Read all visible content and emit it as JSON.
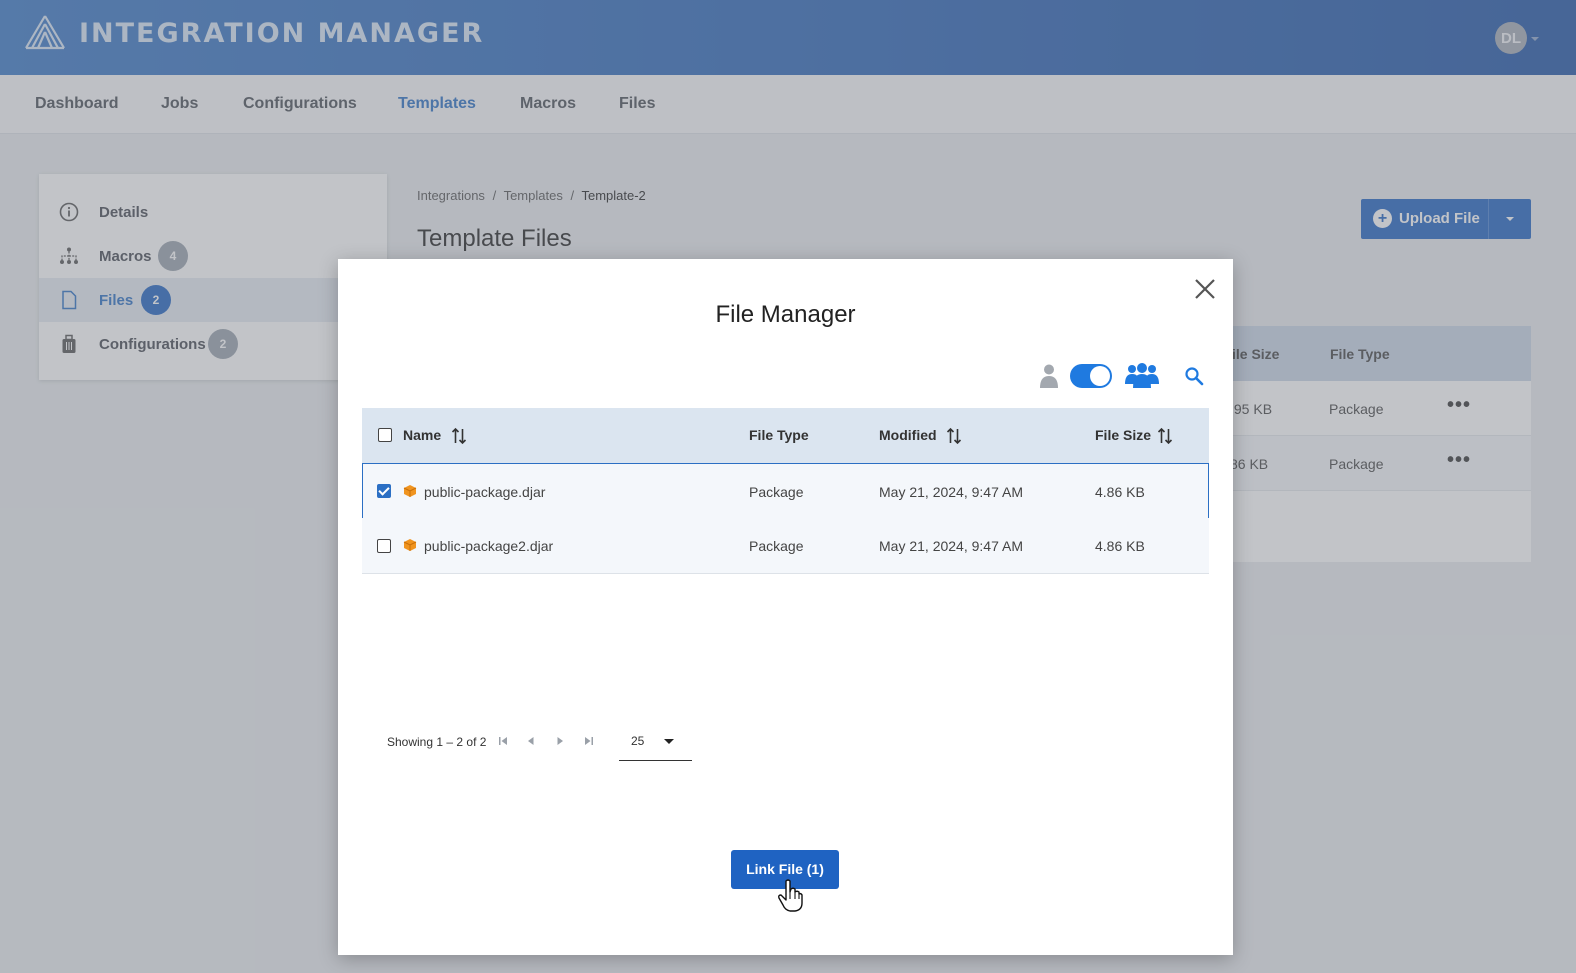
{
  "app": {
    "title": "INTEGRATION MANAGER",
    "user_initials": "DL"
  },
  "nav": {
    "items": [
      {
        "label": "Dashboard",
        "active": false
      },
      {
        "label": "Jobs",
        "active": false
      },
      {
        "label": "Configurations",
        "active": false
      },
      {
        "label": "Templates",
        "active": true
      },
      {
        "label": "Macros",
        "active": false
      },
      {
        "label": "Files",
        "active": false
      }
    ]
  },
  "sidebar": {
    "items": [
      {
        "label": "Details",
        "icon": "info-icon"
      },
      {
        "label": "Macros",
        "icon": "hierarchy-icon",
        "badge": "4"
      },
      {
        "label": "Files",
        "icon": "file-icon",
        "badge": "2",
        "active": true
      },
      {
        "label": "Configurations",
        "icon": "luggage-icon",
        "badge": "2"
      }
    ]
  },
  "page": {
    "breadcrumb": [
      "Integrations",
      "/",
      "Templates",
      "/",
      "Template-2"
    ],
    "title": "Template Files",
    "upload_label": "Upload File",
    "bg_table": {
      "headers": [
        "ile Size",
        "File Type"
      ],
      "rows": [
        {
          "size": ".95 KB",
          "type": "Package"
        },
        {
          "size": "86 KB",
          "type": "Package"
        }
      ]
    }
  },
  "modal": {
    "title": "File Manager",
    "columns": {
      "name": "Name",
      "type": "File Type",
      "modified": "Modified",
      "size": "File Size"
    },
    "rows": [
      {
        "name": "public-package.djar",
        "type": "Package",
        "modified": "May 21, 2024, 9:47 AM",
        "size": "4.86 KB",
        "checked": true
      },
      {
        "name": "public-package2.djar",
        "type": "Package",
        "modified": "May 21, 2024, 9:47 AM",
        "size": "4.86 KB",
        "checked": false
      }
    ],
    "pager": {
      "text": "Showing 1 – 2 of 2",
      "per_page": "25"
    },
    "link_button": "Link File (1)"
  },
  "colors": {
    "primary": "#1f63c2",
    "header_start": "#3a78c6",
    "header_end": "#1f54a6",
    "package_icon": "#f0941f"
  }
}
